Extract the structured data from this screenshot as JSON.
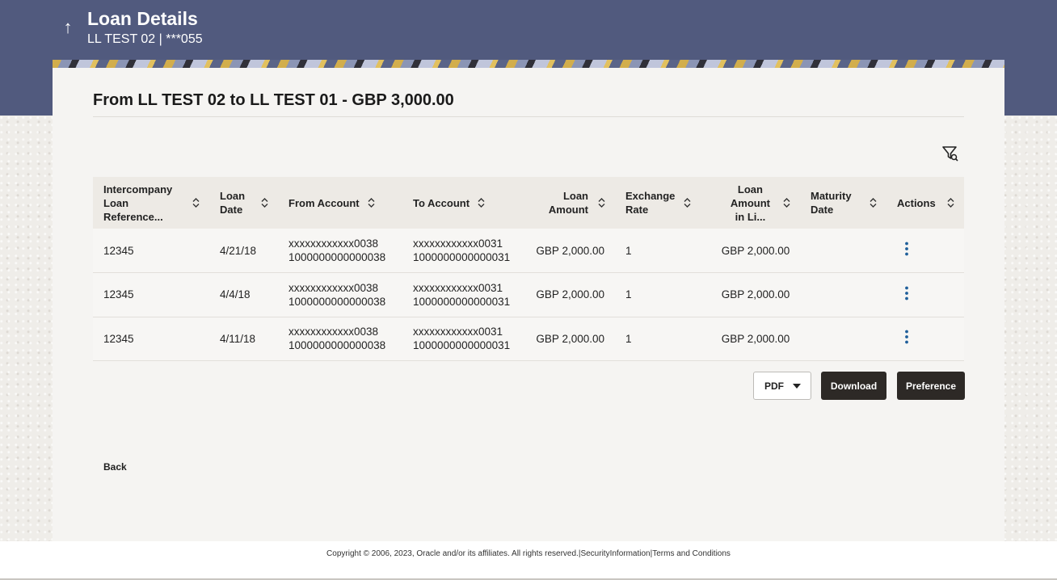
{
  "header": {
    "title": "Loan Details",
    "subtitle": "LL TEST 02 | ***055"
  },
  "card": {
    "title": "From LL TEST 02 to LL TEST 01 - GBP 3,000.00"
  },
  "table": {
    "columns": [
      {
        "line1": "Intercompany",
        "line2": "Loan",
        "line3": "Reference..."
      },
      {
        "line1": "Loan",
        "line2": "Date"
      },
      {
        "line1": "From Account"
      },
      {
        "line1": "To Account"
      },
      {
        "line1": "Loan",
        "line2": "Amount"
      },
      {
        "line1": "Exchange",
        "line2": "Rate"
      },
      {
        "line1": "Loan",
        "line2": "Amount",
        "line3": "in Li..."
      },
      {
        "line1": "Maturity",
        "line2": "Date"
      },
      {
        "line1": "Actions"
      }
    ],
    "rows": [
      {
        "ref": "12345",
        "date": "4/21/18",
        "from_masked": "xxxxxxxxxxxx0038",
        "from_full": "1000000000000038",
        "to_masked": "xxxxxxxxxxxx0031",
        "to_full": "1000000000000031",
        "amount": "GBP 2,000.00",
        "rate": "1",
        "amount_limit": "GBP 2,000.00",
        "maturity": ""
      },
      {
        "ref": "12345",
        "date": "4/4/18",
        "from_masked": "xxxxxxxxxxxx0038",
        "from_full": "1000000000000038",
        "to_masked": "xxxxxxxxxxxx0031",
        "to_full": "1000000000000031",
        "amount": "GBP 2,000.00",
        "rate": "1",
        "amount_limit": "GBP 2,000.00",
        "maturity": ""
      },
      {
        "ref": "12345",
        "date": "4/11/18",
        "from_masked": "xxxxxxxxxxxx0038",
        "from_full": "1000000000000038",
        "to_masked": "xxxxxxxxxxxx0031",
        "to_full": "1000000000000031",
        "amount": "GBP 2,000.00",
        "rate": "1",
        "amount_limit": "GBP 2,000.00",
        "maturity": ""
      }
    ]
  },
  "controls": {
    "format_selected": "PDF",
    "download_label": "Download",
    "preference_label": "Preference"
  },
  "back_label": "Back",
  "footer": {
    "copyright": "Copyright © 2006, 2023, Oracle and/or its affiliates. All rights reserved.",
    "sep1": "|",
    "security": "SecurityInformation",
    "sep2": "|",
    "terms": "Terms and Conditions"
  },
  "colors": {
    "header_bg": "#515a7e",
    "button_bg": "#2d2926",
    "kebab": "#1f5f9a"
  }
}
